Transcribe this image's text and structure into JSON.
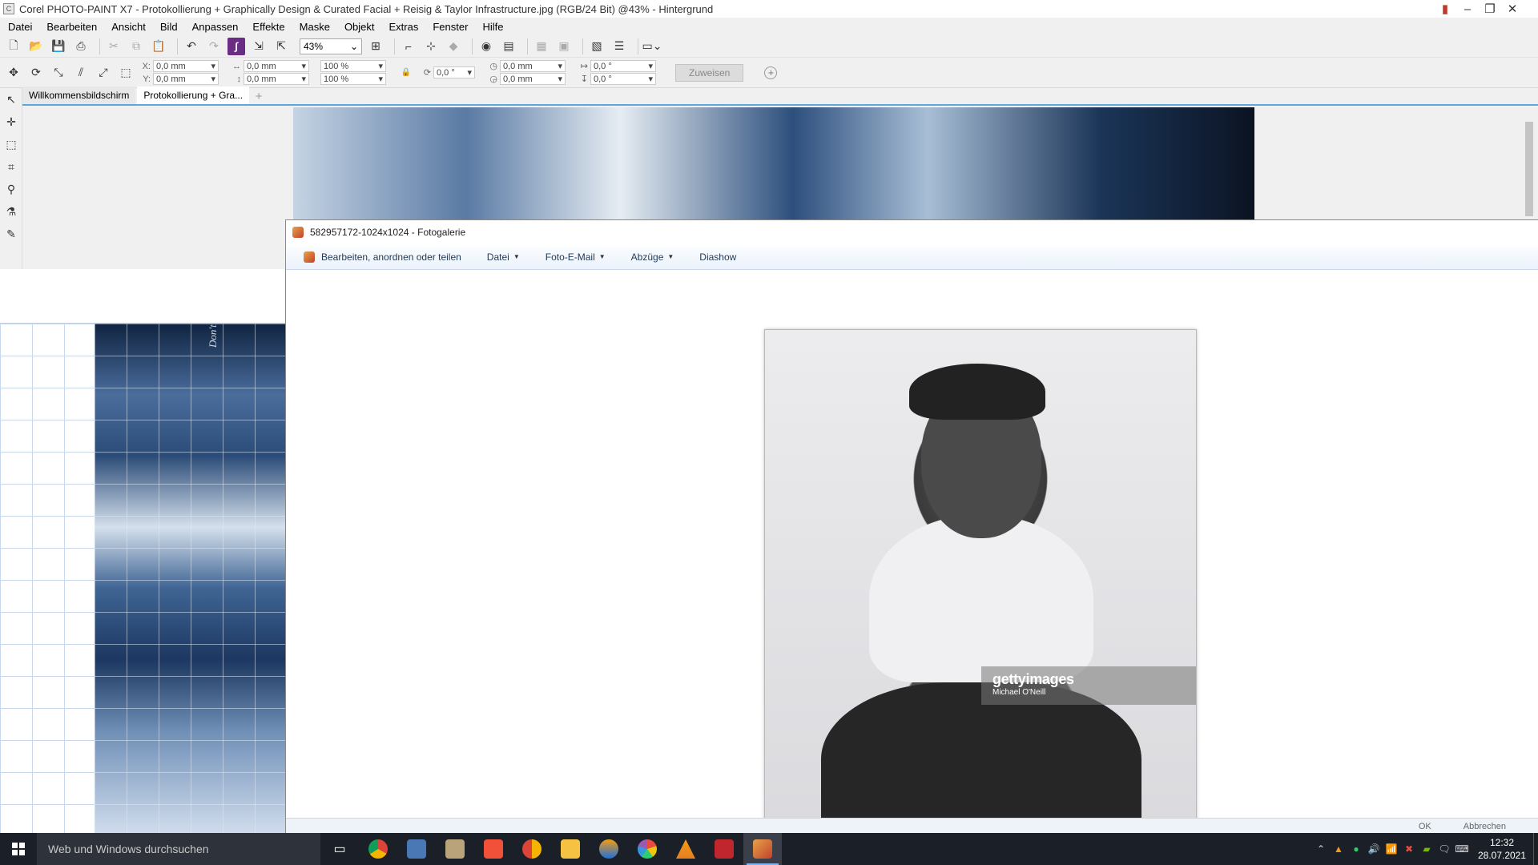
{
  "corel": {
    "title": "Corel PHOTO-PAINT X7 - Protokollierung + Graphically Design & Curated Facial + Reisig & Taylor Infrastructure.jpg (RGB/24 Bit) @43% - Hintergrund",
    "menu": [
      "Datei",
      "Bearbeiten",
      "Ansicht",
      "Bild",
      "Anpassen",
      "Effekte",
      "Maske",
      "Objekt",
      "Extras",
      "Fenster",
      "Hilfe"
    ],
    "zoom": "43%",
    "fields": {
      "x_label": "X:",
      "x_value": "0,0 mm",
      "y_label": "Y:",
      "y_value": "0,0 mm",
      "w_value": "0,0 mm",
      "h_value": "0,0 mm",
      "scale_x": "100 %",
      "scale_y": "100 %",
      "rotate": "0,0 °",
      "center_x": "0,0 mm",
      "center_y": "0,0 mm",
      "skew_x": "0,0 °",
      "skew_y": "0,0 °"
    },
    "assign_button": "Zuweisen",
    "tabs": [
      "Willkommensbildschirm",
      "Protokollierung + Gra..."
    ],
    "vertical_text": "Don't Expect Me Like You Expect Jesus To Come Back"
  },
  "gallery": {
    "title": "582957172-1024x1024 - Fotogalerie",
    "commands": [
      {
        "label": "Bearbeiten, anordnen oder teilen",
        "has_dropdown": false
      },
      {
        "label": "Datei",
        "has_dropdown": true
      },
      {
        "label": "Foto-E-Mail",
        "has_dropdown": true
      },
      {
        "label": "Abzüge",
        "has_dropdown": true
      },
      {
        "label": "Diashow",
        "has_dropdown": false
      }
    ],
    "watermark_brand": "gettyimages",
    "watermark_credit": "Michael O'Neill",
    "image_id": "582957172",
    "status": [
      "OK",
      "Abbrechen"
    ]
  },
  "taskbar": {
    "search_placeholder": "Web und Windows durchsuchen",
    "apps": [
      "task-view",
      "chrome",
      "calculator-app",
      "photo-app",
      "swift-app",
      "chrome-alt",
      "file-explorer",
      "media-app",
      "picasa",
      "vlc",
      "camera-app",
      "photo-gallery"
    ],
    "time": "12:32",
    "date": "28.07.2021"
  },
  "colors": {
    "accent_blue": "#5ea7dc",
    "taskbar": "#1b1f27",
    "brand_purple": "#6b2d83"
  }
}
